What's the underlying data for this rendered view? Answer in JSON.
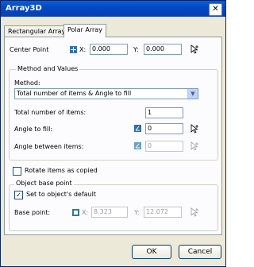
{
  "window": {
    "title": "Array3D",
    "close_glyph": "✕"
  },
  "tabs": [
    {
      "label": "Rectangular Array",
      "active": false
    },
    {
      "label": "Polar Array",
      "active": true
    }
  ],
  "center_point": {
    "label": "Center Point",
    "x_label": "X:",
    "x_value": "0.000",
    "y_label": "Y:",
    "y_value": "0.000"
  },
  "method_group": {
    "title": "Method and Values",
    "method_label": "Method:",
    "method_value": "Total number of items & Angle to fill",
    "total_label": "Total number of items:",
    "total_value": "1",
    "angle_fill_label": "Angle to fill:",
    "angle_fill_value": "0",
    "angle_between_label": "Angle between items:",
    "angle_between_value": "0"
  },
  "rotate_items": {
    "label": "Rotate items as copied",
    "checked": false
  },
  "base_point_group": {
    "title": "Object base point",
    "set_default_label": "Set to object's default",
    "set_default_checked": true,
    "base_point_label": "Base point:",
    "x_label": "X:",
    "x_value": "8.323",
    "y_label": "Y:",
    "y_value": "12.072"
  },
  "buttons": {
    "ok": "OK",
    "cancel": "Cancel"
  },
  "icons": {
    "pick": "pointer-pick-icon",
    "center": "crosshair-icon",
    "angle": "angle-icon",
    "base": "base-point-icon"
  },
  "colors": {
    "titlebar": "#0549c4",
    "dialog_bg": "#ece9d8",
    "panel_bg": "#fcfcfe",
    "accent": "#0a5fd8"
  }
}
